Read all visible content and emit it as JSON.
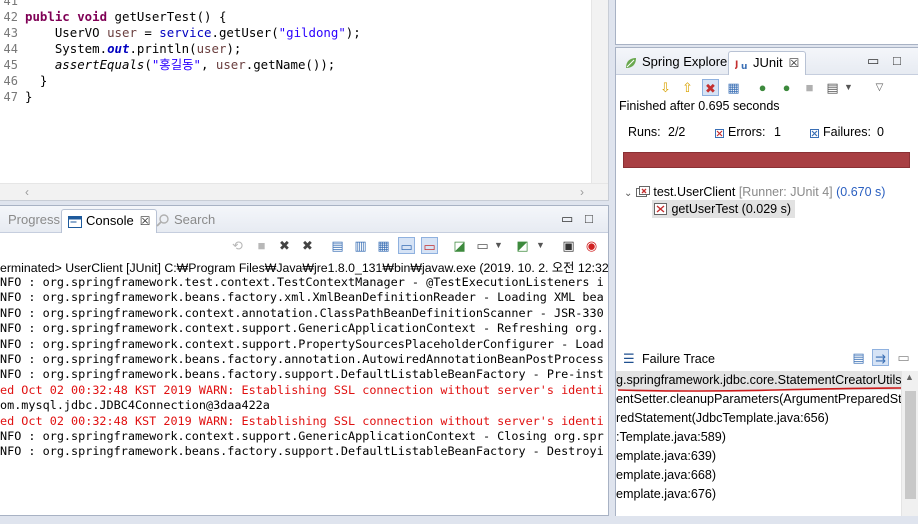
{
  "editor": {
    "line_numbers": [
      "41",
      "42",
      "43",
      "44",
      "45",
      "46",
      "47"
    ],
    "lines": [
      {
        "kw": "public void ",
        "rest": "getUserTest() {"
      },
      {
        "pre": "    UserVO ",
        "var": "user",
        "mid": " = ",
        "var2": "service",
        "post": ".getUser(",
        "str": "\"gildong\"",
        "end": ");"
      },
      {
        "pre": "    System.",
        "fld": "out",
        "post": ".println(",
        "var": "user",
        "end": ");"
      },
      {
        "pre": "    ",
        "it": "assertEquals",
        "post": "(",
        "str": "\"홍길동\"",
        "mid": ", ",
        "var": "user",
        "end": ".getName());"
      },
      {
        "pre": "  }"
      },
      {
        "pre": "}"
      },
      {
        "pre": ""
      }
    ]
  },
  "console_panel": {
    "tabs": [
      {
        "label": "Progress",
        "icon": "progress-icon",
        "active": false
      },
      {
        "label": "Console",
        "icon": "console-icon",
        "active": true
      },
      {
        "label": "Search",
        "icon": "search-icon",
        "active": false
      }
    ],
    "close_glyph": "☒",
    "minimize_glyph": "▭",
    "maximize_glyph": "□",
    "status": "erminated> UserClient [JUnit] C:₩Program Files₩Java₩jre1.8.0_131₩bin₩javaw.exe (2019. 10. 2. 오전 12:32:47)",
    "lines": [
      {
        "type": "info",
        "text": "NFO : org.springframework.test.context.TestContextManager - @TestExecutionListeners i"
      },
      {
        "type": "info",
        "text": "NFO : org.springframework.beans.factory.xml.XmlBeanDefinitionReader - Loading XML bea"
      },
      {
        "type": "info",
        "text": "NFO : org.springframework.context.annotation.ClassPathBeanDefinitionScanner - JSR-330"
      },
      {
        "type": "info",
        "text": "NFO : org.springframework.context.support.GenericApplicationContext - Refreshing org."
      },
      {
        "type": "info",
        "text": "NFO : org.springframework.context.support.PropertySourcesPlaceholderConfigurer - Load"
      },
      {
        "type": "info",
        "text": "NFO : org.springframework.beans.factory.annotation.AutowiredAnnotationBeanPostProcess"
      },
      {
        "type": "info",
        "text": "NFO : org.springframework.beans.factory.support.DefaultListableBeanFactory - Pre-inst"
      },
      {
        "type": "err",
        "text": "ed Oct 02 00:32:48 KST 2019 WARN: Establishing SSL connection without server's identi"
      },
      {
        "type": "info",
        "text": "om.mysql.jdbc.JDBC4Connection@3daa422a"
      },
      {
        "type": "err",
        "text": "ed Oct 02 00:32:48 KST 2019 WARN: Establishing SSL connection without server's identi"
      },
      {
        "type": "info",
        "text": "NFO : org.springframework.context.support.GenericApplicationContext - Closing org.spr"
      },
      {
        "type": "info",
        "text": "NFO : org.springframework.beans.factory.support.DefaultListableBeanFactory - Destroyi"
      }
    ]
  },
  "junit_panel": {
    "tabs": [
      {
        "label": "Spring Explorer",
        "icon": "spring-leaf-icon",
        "active": false
      },
      {
        "label": "JUnit",
        "icon": "junit-icon",
        "active": true
      }
    ],
    "close_glyph": "☒",
    "minimize_glyph": "▭",
    "maximize_glyph": "□",
    "finished": "Finished after 0.695 seconds",
    "counts": {
      "runs_label": "Runs:",
      "runs_value": "2/2",
      "errors_label": "Errors:",
      "errors_value": "1",
      "failures_label": "Failures:",
      "failures_value": "0"
    },
    "progress": {
      "fraction": 1.0,
      "color": "#a83f43"
    },
    "tree": {
      "suite": {
        "name": "test.UserClient",
        "runner": "[Runner: JUnit 4]",
        "time": "(0.670 s)"
      },
      "test": {
        "name": "getUserTest",
        "time": "(0.029 s)"
      }
    },
    "failure_trace_label": "Failure Trace",
    "trace_lines": [
      "g.springframework.jdbc.core.StatementCreatorUtils",
      "entSetter.cleanupParameters(ArgumentPreparedState",
      "redStatement(JdbcTemplate.java:656)",
      ":Template.java:589)",
      "emplate.java:639)",
      "emplate.java:668)",
      "emplate.java:676)"
    ]
  },
  "colors": {
    "keyword": "#7f0055",
    "string": "#2a00ff",
    "error_text": "#e01010",
    "annotation_underline": "#cc1b1b",
    "failure_bar": "#a83f43"
  }
}
